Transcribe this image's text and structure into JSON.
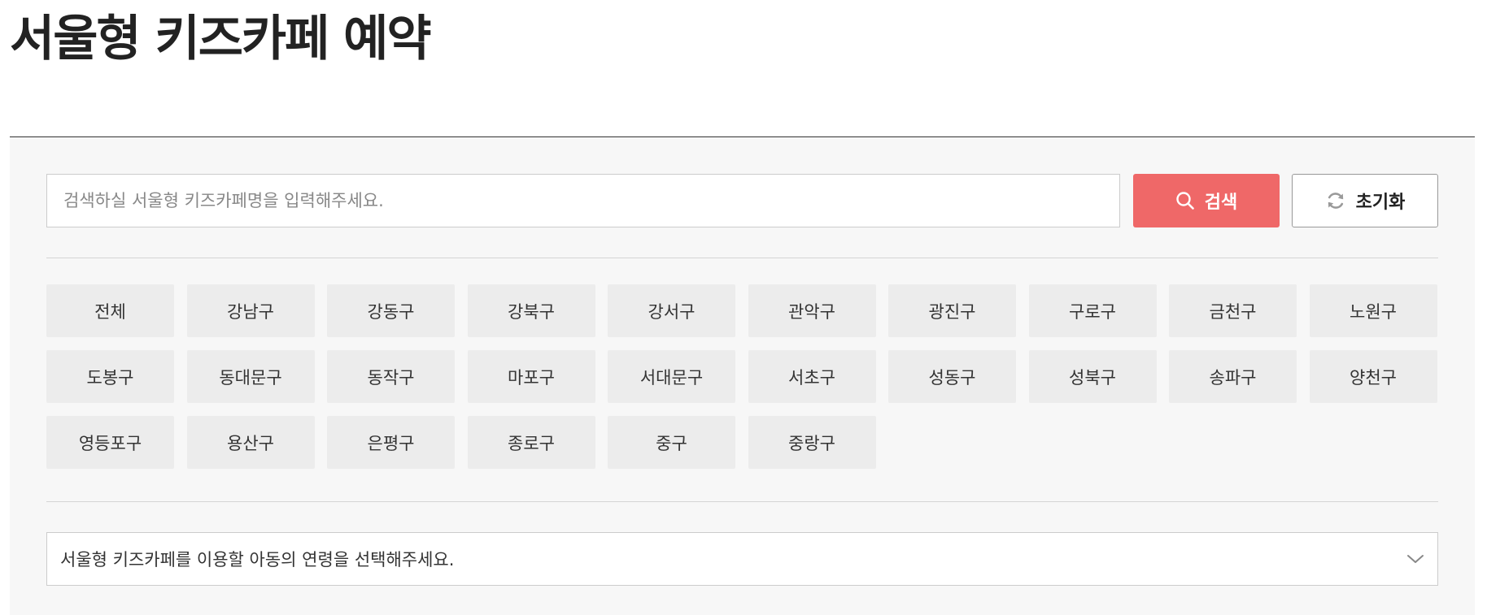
{
  "header": {
    "title": "서울형 키즈카페 예약"
  },
  "search": {
    "placeholder": "검색하실 서울형 키즈카페명을 입력해주세요.",
    "value": "",
    "search_label": "검색",
    "reset_label": "초기화"
  },
  "districts": [
    "전체",
    "강남구",
    "강동구",
    "강북구",
    "강서구",
    "관악구",
    "광진구",
    "구로구",
    "금천구",
    "노원구",
    "도봉구",
    "동대문구",
    "동작구",
    "마포구",
    "서대문구",
    "서초구",
    "성동구",
    "성북구",
    "송파구",
    "양천구",
    "영등포구",
    "용산구",
    "은평구",
    "종로구",
    "중구",
    "중랑구"
  ],
  "age_select": {
    "label": "서울형 키즈카페를 이용할 아동의 연령을 선택해주세요."
  },
  "colors": {
    "accent": "#ef6868",
    "panel_bg": "#f7f7f7",
    "chip_bg": "#ececec"
  },
  "icons": {
    "search": "search-icon",
    "reset": "refresh-icon",
    "dropdown": "chevron-down-icon"
  }
}
